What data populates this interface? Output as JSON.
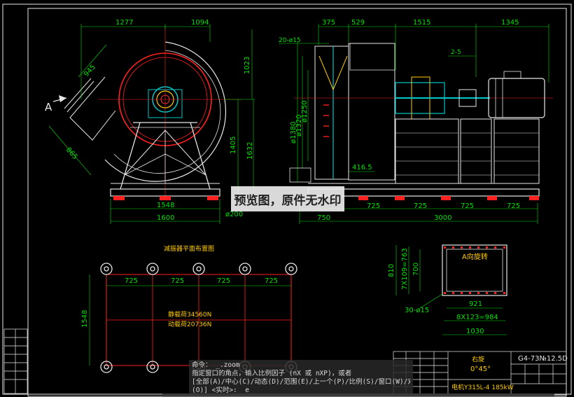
{
  "drawing": {
    "front_view": {
      "dims_top": [
        "1277",
        "1094"
      ],
      "dims_right": [
        "1023",
        "1405",
        "1632"
      ],
      "dims_diag": [
        "945",
        "865"
      ],
      "dims_bottom": [
        "1548",
        "1600"
      ],
      "dim_anchor": "ø200",
      "view_marker": "A"
    },
    "side_view": {
      "dims_top": [
        "375",
        "529",
        "1515",
        "1345"
      ],
      "note_holes": "20-ø15",
      "note_gap": "2-5",
      "dims_vertical": [
        "ø1380",
        "ø1320",
        "ø1250"
      ],
      "dim_offset": "416.5",
      "dims_bottom_spacing": [
        "725",
        "725",
        "725",
        "725"
      ],
      "dims_bottom_total": [
        "750",
        "3000"
      ]
    },
    "foundation_plan": {
      "title": "减振器平面布置图",
      "spacing": [
        "725",
        "725",
        "725",
        "725"
      ],
      "height": "1548",
      "load1": "静载荷34560N",
      "load2": "动载荷20736N"
    },
    "flange_view": {
      "title": "A向旋转",
      "left_dims": [
        "810",
        "7X109=763",
        "700"
      ],
      "bottom_dims": [
        "921",
        "8X123=984",
        "1030"
      ],
      "hole_note": "30-ø15"
    },
    "title_block": {
      "model": "G4-73№12.5D",
      "rotation_label": "右旋",
      "angle": "0°45°",
      "motor": "电机Y315L-4 185kW"
    }
  },
  "watermark": "预览图，原件无水印",
  "command": {
    "line1": "命令：  _.zoom",
    "line2": "指定窗口的角点，输入比例因子 (nX 或 nXP)，或者",
    "line3": "[全部(A)/中心(C)/动态(D)/范围(E)/上一个(P)/比例(S)/窗口(W)/对象",
    "line4": "(O)] <实时>: _e"
  }
}
